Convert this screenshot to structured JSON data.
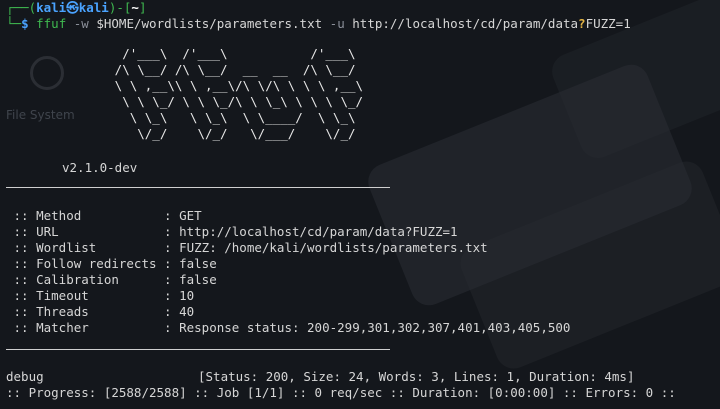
{
  "prompt": {
    "corner_top": "┌──(",
    "user": "kali",
    "at": "㉿",
    "host": "kali",
    "mid": ")-[",
    "path": "~",
    "end": "]",
    "corner_bottom": "└─",
    "symbol": "$"
  },
  "command": {
    "program": "ffuf",
    "flag_w": "-w",
    "wordlist": "$HOME/wordlists/parameters.txt",
    "flag_u": "-u",
    "url_prefix": "http://localhost/cd/param/data",
    "url_q": "?",
    "url_suffix": "FUZZ=1"
  },
  "banner": {
    "ascii": "        /'___\\  /'___\\           /'___\\\n       /\\ \\__/ /\\ \\__/  __  __  /\\ \\__/\n       \\ \\ ,__\\\\ \\ ,__\\/\\ \\/\\ \\ \\ \\ ,__\\\n        \\ \\ \\_/ \\ \\ \\_/\\ \\ \\_\\ \\ \\ \\ \\_/\n         \\ \\_\\   \\ \\_\\  \\ \\____/  \\ \\_\\\n          \\/_/    \\/_/   \\/___/    \\/_/",
    "version": "v2.1.0-dev"
  },
  "desktop": {
    "label": "File System"
  },
  "config": [
    {
      "key": " :: Method           ",
      "value": ": GET"
    },
    {
      "key": " :: URL              ",
      "value": ": http://localhost/cd/param/data?FUZZ=1"
    },
    {
      "key": " :: Wordlist         ",
      "value": ": FUZZ: /home/kali/wordlists/parameters.txt"
    },
    {
      "key": " :: Follow redirects ",
      "value": ": false"
    },
    {
      "key": " :: Calibration      ",
      "value": ": false"
    },
    {
      "key": " :: Timeout          ",
      "value": ": 10"
    },
    {
      "key": " :: Threads          ",
      "value": ": 40"
    },
    {
      "key": " :: Matcher          ",
      "value": ": Response status: 200-299,301,302,307,401,403,405,500"
    }
  ],
  "result": {
    "word": "debug",
    "status": "[Status: 200, Size: 24, Words: 3, Lines: 1, Duration: 4ms]"
  },
  "progress": ":: Progress: [2588/2588] :: Job [1/1] :: 0 req/sec :: Duration: [0:00:00] :: Errors: 0 ::",
  "colors": {
    "prompt_green": "#3fb950",
    "prompt_blue": "#4aa3ff",
    "background": "#14171c"
  }
}
